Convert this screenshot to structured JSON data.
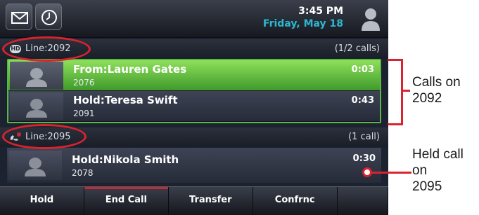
{
  "status_bar": {
    "messages_icon": "envelope-icon",
    "history_icon": "clock-icon",
    "time": "3:45 PM",
    "date": "Friday, May 18",
    "user_icon": "user-avatar-icon"
  },
  "lines": [
    {
      "label": "Line:2092",
      "badge": "HD",
      "count": "(1/2 calls)",
      "calls": [
        {
          "name": "From:Lauren Gates",
          "number": "2076",
          "timer": "0:03",
          "state": "active"
        },
        {
          "name": "Hold:Teresa Swift",
          "number": "2091",
          "timer": "0:43",
          "state": "hold"
        }
      ]
    },
    {
      "label": "Line:2095",
      "count": "(1 call)",
      "calls": [
        {
          "name": "Hold:Nikola Smith",
          "number": "2078",
          "timer": "0:30",
          "state": "hold"
        }
      ]
    }
  ],
  "softkeys": [
    "Hold",
    "End Call",
    "Transfer",
    "Confrnc"
  ],
  "annotations": {
    "calls_on_2092": [
      "Calls on",
      "2092"
    ],
    "held_call_2095": [
      "Held call",
      "on",
      "2095"
    ]
  },
  "colors": {
    "annotation_red": "#d9232e",
    "active_call_green": "#57b84a",
    "date_cyan": "#2eb7cf"
  }
}
